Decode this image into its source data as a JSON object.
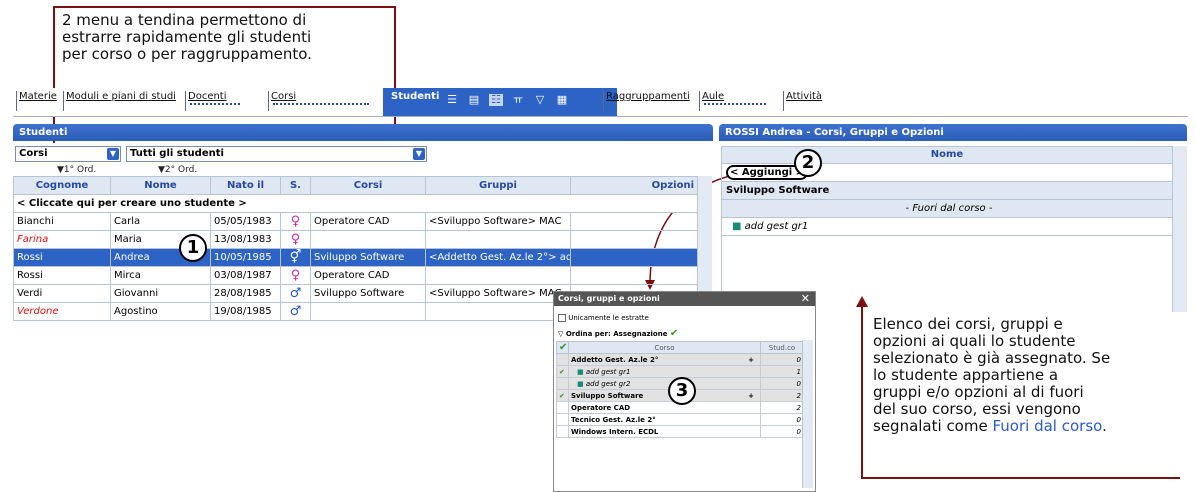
{
  "callout_top": "2 menu a tendina permettono di\nestrarre rapidamente gli studenti\nper corso o per raggruppamento.",
  "callout_right": "Elenco dei corsi, gruppi e\nopzioni ai quali lo studente\nselezionato è già assegnato. Se\nlo studente appartiene a\ngruppi e/o opzioni al di fuori\ndel suo corso, essi vengono\nsegnalati come ",
  "callout_right_link": "Fuori dal corso",
  "callout_right_end": ".",
  "markers": {
    "m1": "1",
    "m2": "2",
    "m3": "3"
  },
  "tabs": {
    "materie": "Materie",
    "moduli": "Moduli e piani di studi",
    "docenti": "Docenti",
    "corsi": "Corsi",
    "studenti": "Studenti",
    "raggruppamenti": "Raggruppamenti",
    "aule": "Aule",
    "attivita": "Attività"
  },
  "left_panel": {
    "title": "Studenti",
    "dropdown_corsi": "Corsi",
    "dropdown_studenti": "Tutti gli studenti",
    "sort1": "▼1° Ord.",
    "sort2": "▼2° Ord.",
    "columns": [
      "Cognome",
      "Nome",
      "Nato il",
      "S.",
      "Corsi",
      "Gruppi",
      "Opzioni"
    ],
    "create_row": "< Cliccate qui per creare uno studente >",
    "rows": [
      {
        "cognome": "Bianchi",
        "nome": "Carla",
        "nato": "05/05/1983",
        "sex": "♀",
        "corsi": "Operatore CAD",
        "gruppi": "<Sviluppo Software> MAC",
        "opzioni": ""
      },
      {
        "cognome": "Farina",
        "nome": "Maria",
        "nato": "13/08/1983",
        "sex": "♀",
        "corsi": "",
        "gruppi": "",
        "opzioni": ""
      },
      {
        "cognome": "Rossi",
        "nome": "Andrea",
        "nato": "10/05/1985",
        "sex": "⚥",
        "corsi": "Sviluppo Software",
        "gruppi": "<Addetto Gest. Az.le  2°> ad",
        "opzioni": ""
      },
      {
        "cognome": "Rossi",
        "nome": "Mirca",
        "nato": "03/08/1987",
        "sex": "♀",
        "corsi": "Operatore CAD",
        "gruppi": "",
        "opzioni": ""
      },
      {
        "cognome": "Verdi",
        "nome": "Giovanni",
        "nato": "28/08/1985",
        "sex": "♂",
        "corsi": "Sviluppo Software",
        "gruppi": "<Sviluppo Software> MAC",
        "opzioni": ""
      },
      {
        "cognome": "Verdone",
        "nome": "Agostino",
        "nato": "19/08/1985",
        "sex": "♂",
        "corsi": "",
        "gruppi": "",
        "opzioni": ""
      }
    ]
  },
  "right_panel": {
    "title": "ROSSI Andrea - Corsi, Gruppi e Opzioni",
    "column": "Nome",
    "add_button": "< Aggiungi >",
    "course": "Sviluppo Software",
    "fuori": "- Fuori dal corso -",
    "item": "add gest gr1"
  },
  "dialog": {
    "title": "Corsi, gruppi e opzioni",
    "close": "✕",
    "checkbox_label": "Unicamente le estratte",
    "sort_label": "Ordina per: Assegnazione",
    "columns": [
      "Corso",
      "Stud.co"
    ],
    "rows": [
      {
        "check": "",
        "name": "Addetto Gest. Az.le  2°",
        "plus": "+",
        "count": "0",
        "indent": false,
        "italic": false
      },
      {
        "check": "✔",
        "name": "add gest gr1",
        "plus": "",
        "count": "1",
        "indent": true,
        "italic": true
      },
      {
        "check": "",
        "name": "add gest gr2",
        "plus": "",
        "count": "0",
        "indent": true,
        "italic": true
      },
      {
        "check": "✔",
        "name": "Sviluppo Software",
        "plus": "+",
        "count": "2",
        "indent": false,
        "italic": false
      },
      {
        "check": "",
        "name": "Operatore CAD",
        "plus": "",
        "count": "2",
        "indent": false,
        "italic": false
      },
      {
        "check": "",
        "name": "Tecnico Gest. Az.le 2°",
        "plus": "",
        "count": "0",
        "indent": false,
        "italic": false
      },
      {
        "check": "",
        "name": "Windows Intern. ECDL",
        "plus": "",
        "count": "0",
        "indent": false,
        "italic": false
      }
    ]
  },
  "colors": {
    "accent": "#2e63c6",
    "callout_line": "#7a1010",
    "female": "#d02aa6",
    "male": "#1f53c8",
    "link": "#2a5bd0"
  }
}
